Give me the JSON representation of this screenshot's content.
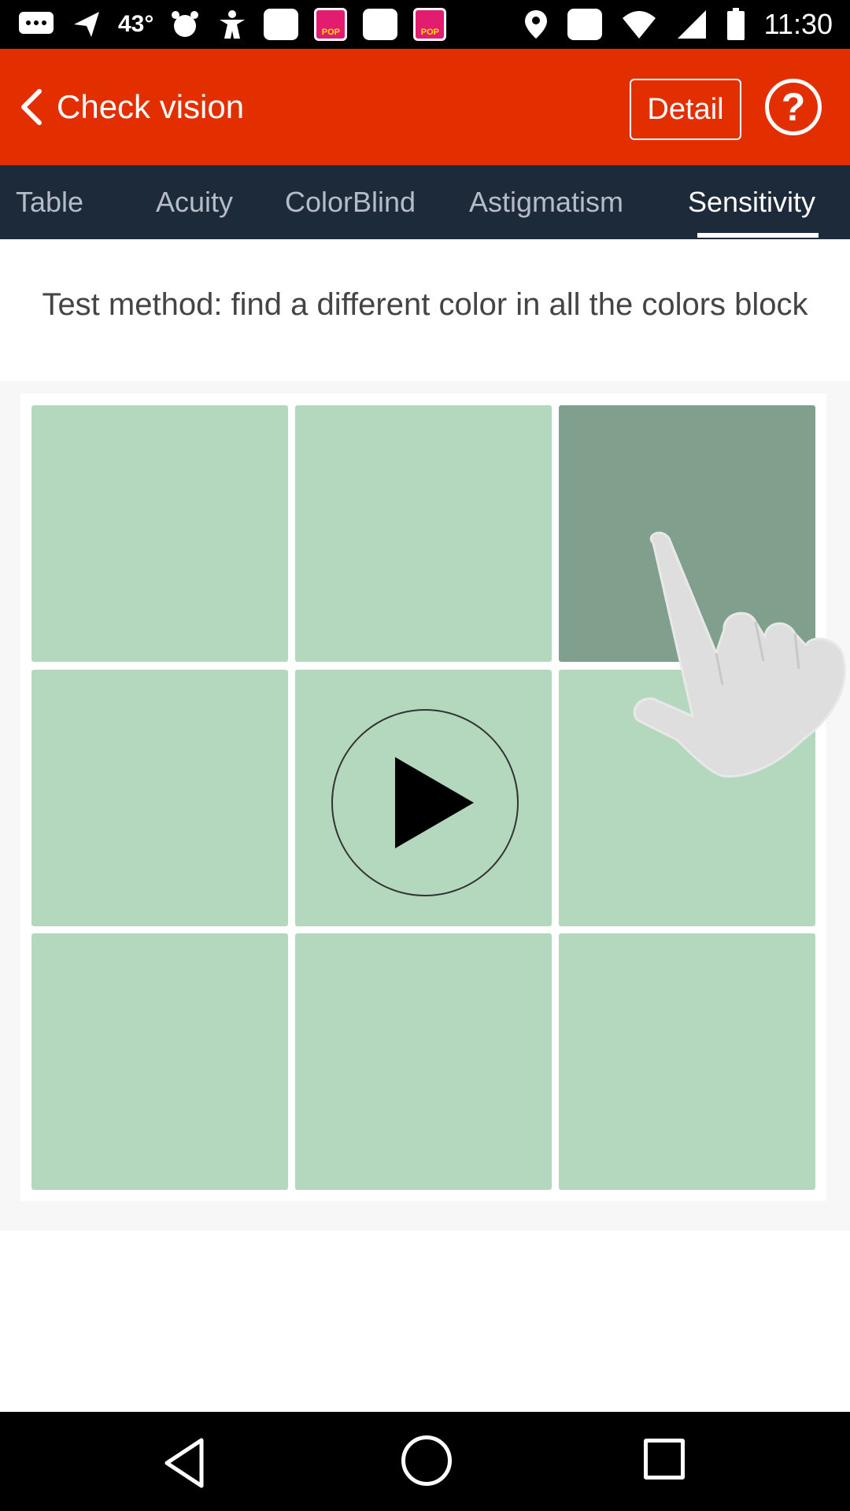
{
  "status": {
    "time": "11:30",
    "temperature": "43°"
  },
  "header": {
    "title": "Check vision",
    "detail_label": "Detail",
    "help_symbol": "?",
    "accent_color": "#e32f00"
  },
  "tabs": [
    {
      "label": "Table",
      "active": false
    },
    {
      "label": "Acuity",
      "active": false
    },
    {
      "label": "ColorBlind",
      "active": false
    },
    {
      "label": "Astigmatism",
      "active": false
    },
    {
      "label": "Sensitivity",
      "active": true
    }
  ],
  "content": {
    "instructions": "Test method: find a different color in all the colors block",
    "grid": {
      "rows": 3,
      "cols": 3,
      "base_color": "#b3d8be",
      "odd_color": "#809f8c",
      "odd_cell": {
        "row": 1,
        "col": 3
      }
    },
    "play_icon": "play-icon",
    "hand_icon": "pointing-hand-icon"
  },
  "nav": {
    "back_icon": "back-triangle-icon",
    "home_icon": "home-circle-icon",
    "recent_icon": "recent-square-icon"
  }
}
